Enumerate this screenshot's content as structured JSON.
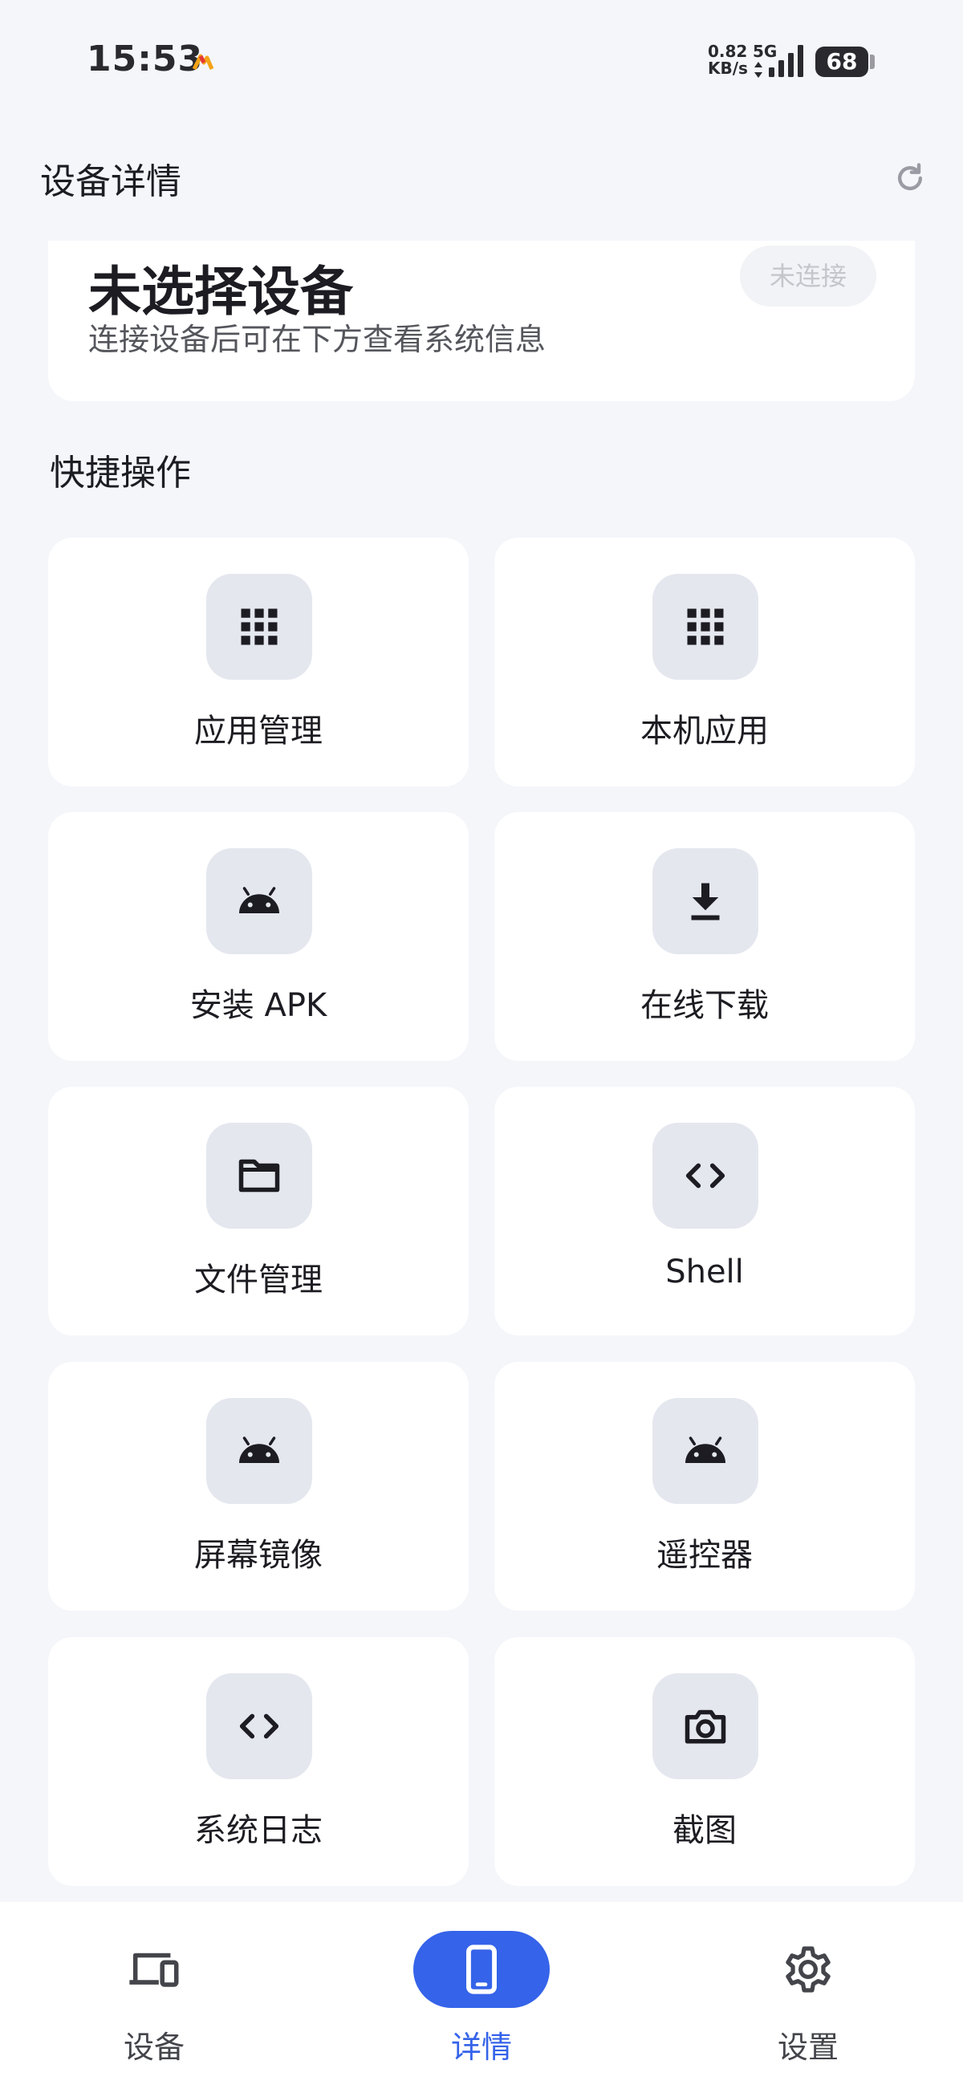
{
  "status_bar": {
    "time": "15:53",
    "net_speed_value": "0.82",
    "net_speed_unit": "KB/s",
    "network_type": "5G",
    "battery": "68"
  },
  "header": {
    "title": "设备详情",
    "refresh_icon": "refresh-icon"
  },
  "device_card": {
    "title": "未选择设备",
    "subtitle": "连接设备后可在下方查看系统信息",
    "status_badge": "未连接"
  },
  "quick_actions": {
    "title": "快捷操作",
    "items": [
      {
        "label": "应用管理",
        "icon": "apps-grid-icon"
      },
      {
        "label": "本机应用",
        "icon": "apps-grid-icon"
      },
      {
        "label": "安装 APK",
        "icon": "android-icon"
      },
      {
        "label": "在线下载",
        "icon": "download-icon"
      },
      {
        "label": "文件管理",
        "icon": "folder-icon"
      },
      {
        "label": "Shell",
        "icon": "code-icon"
      },
      {
        "label": "屏幕镜像",
        "icon": "android-icon"
      },
      {
        "label": "遥控器",
        "icon": "android-icon"
      },
      {
        "label": "系统日志",
        "icon": "code-icon"
      },
      {
        "label": "截图",
        "icon": "camera-icon"
      }
    ]
  },
  "bottom_nav": {
    "items": [
      {
        "label": "设备",
        "icon": "devices-icon",
        "active": false
      },
      {
        "label": "详情",
        "icon": "phone-icon",
        "active": true
      },
      {
        "label": "设置",
        "icon": "gear-icon",
        "active": false
      }
    ]
  },
  "colors": {
    "background": "#f4f6fa",
    "accent": "#3563e9",
    "card": "#ffffff",
    "icon_tile": "#e4e7ee"
  }
}
